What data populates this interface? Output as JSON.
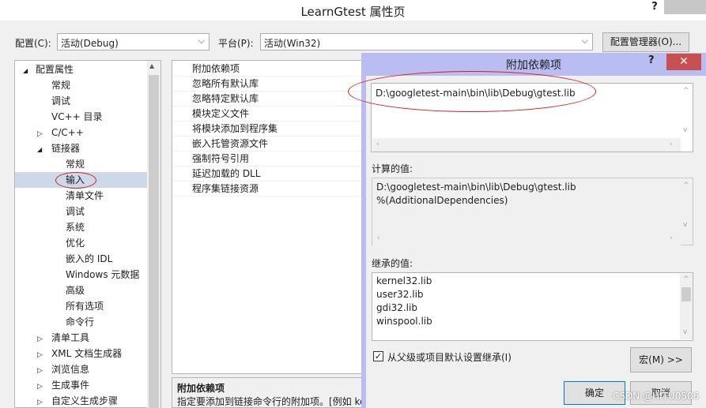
{
  "window": {
    "title": "LearnGtest 属性页",
    "help": "?"
  },
  "toolbar": {
    "config_label": "配置(C):",
    "config_value": "活动(Debug)",
    "platform_label": "平台(P):",
    "platform_value": "活动(Win32)",
    "config_manager_label": "配置管理器(O)..."
  },
  "tree": {
    "items": [
      {
        "label": "配置属性",
        "expander": "◢"
      },
      {
        "label": "常规"
      },
      {
        "label": "调试"
      },
      {
        "label": "VC++ 目录"
      },
      {
        "label": "C/C++",
        "expander": "▷"
      },
      {
        "label": "链接器",
        "expander": "◢"
      },
      {
        "label": "常规"
      },
      {
        "label": "输入"
      },
      {
        "label": "清单文件"
      },
      {
        "label": "调试"
      },
      {
        "label": "系统"
      },
      {
        "label": "优化"
      },
      {
        "label": "嵌入的 IDL"
      },
      {
        "label": "Windows 元数据"
      },
      {
        "label": "高级"
      },
      {
        "label": "所有选项"
      },
      {
        "label": "命令行"
      },
      {
        "label": "清单工具",
        "expander": "▷"
      },
      {
        "label": "XML 文档生成器",
        "expander": "▷"
      },
      {
        "label": "浏览信息",
        "expander": "▷"
      },
      {
        "label": "生成事件",
        "expander": "▷"
      },
      {
        "label": "自定义生成步骤",
        "expander": "▷"
      }
    ]
  },
  "grid": {
    "rows": [
      "附加依赖项",
      "忽略所有默认库",
      "忽略特定默认库",
      "模块定义文件",
      "将模块添加到程序集",
      "嵌入托管资源文件",
      "强制符号引用",
      "延迟加载的 DLL",
      "程序集链接资源"
    ],
    "desc_title": "附加依赖项",
    "desc_text": "指定要添加到链接命令行的附加项。[例如 ke"
  },
  "dialog": {
    "title": "附加依赖项",
    "help": "?",
    "close": "✕",
    "edit_text": "D:\\googletest-main\\bin\\lib\\Debug\\gtest.lib",
    "computed_label": "计算的值:",
    "computed_lines": [
      "D:\\googletest-main\\bin\\lib\\Debug\\gtest.lib",
      "%(AdditionalDependencies)"
    ],
    "inherited_label": "继承的值:",
    "inherited_lines": [
      "kernel32.lib",
      "user32.lib",
      "gdi32.lib",
      "winspool.lib"
    ],
    "inherit_checkbox_label": "从父级或项目默认设置继承(I)",
    "inherit_checked": "✓",
    "macros_label": "宏(M) >>",
    "ok_label": "确定",
    "cancel_label": "取消"
  },
  "watermark": "CSDN @HITU0506",
  "colors": {
    "dialog_frame": "#b9bdf2",
    "close_red": "#c75050",
    "annotation_red": "#d02020",
    "selection": "#cdd9e8"
  }
}
